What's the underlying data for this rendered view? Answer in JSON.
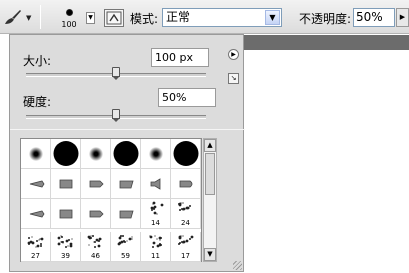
{
  "toolbar": {
    "brush_preset_size": "100",
    "mode_label": "模式:",
    "mode_value": "正常",
    "opacity_label": "不透明度:",
    "opacity_value": "50%"
  },
  "panel": {
    "size_label": "大小:",
    "size_value": "100 px",
    "size_slider_fraction": 0.5,
    "hardness_label": "硬度:",
    "hardness_value": "50%",
    "hardness_slider_fraction": 0.5
  },
  "presets": {
    "rows": [
      [
        {
          "kind": "soft"
        },
        {
          "kind": "hard"
        },
        {
          "kind": "soft"
        },
        {
          "kind": "hard"
        },
        {
          "kind": "soft"
        },
        {
          "kind": "hard"
        }
      ],
      [
        {
          "kind": "tip"
        },
        {
          "kind": "tip"
        },
        {
          "kind": "tip"
        },
        {
          "kind": "tip"
        },
        {
          "kind": "tip"
        },
        {
          "kind": "tip"
        }
      ],
      [
        {
          "kind": "tip"
        },
        {
          "kind": "tip"
        },
        {
          "kind": "tip"
        },
        {
          "kind": "tip"
        },
        {
          "kind": "scatter",
          "label": "14"
        },
        {
          "kind": "scatter",
          "label": "24"
        }
      ],
      [
        {
          "kind": "scatter",
          "label": "27"
        },
        {
          "kind": "scatter",
          "label": "39"
        },
        {
          "kind": "scatter",
          "label": "46"
        },
        {
          "kind": "scatter",
          "label": "59"
        },
        {
          "kind": "scatter",
          "label": "11"
        },
        {
          "kind": "scatter",
          "label": "17"
        }
      ]
    ]
  }
}
